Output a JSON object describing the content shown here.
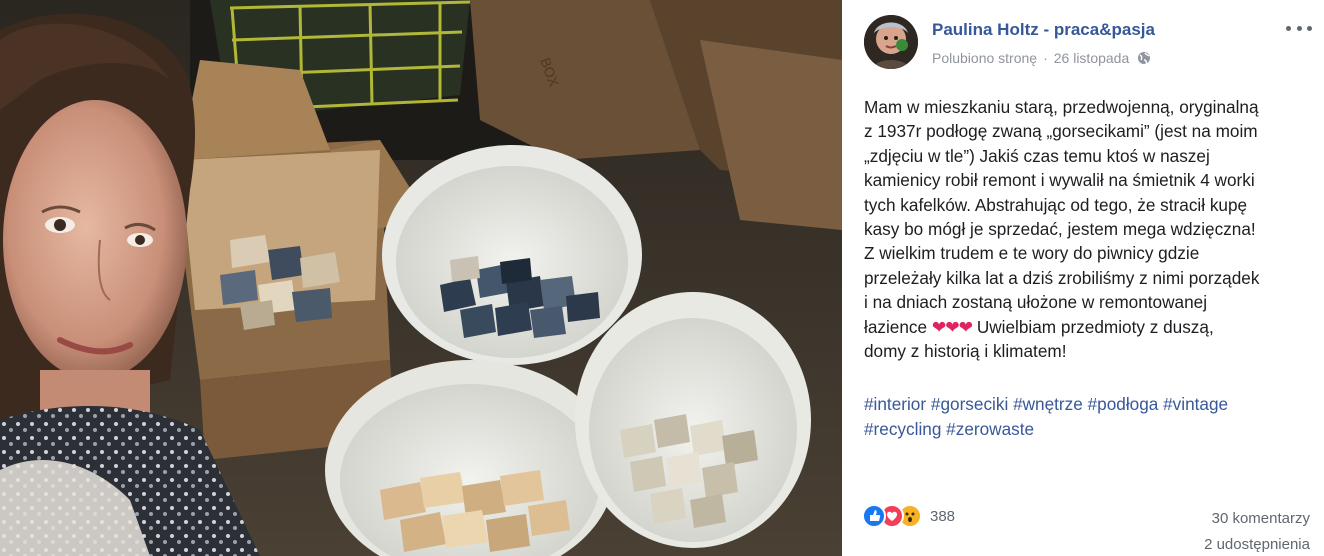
{
  "post": {
    "author": "Paulina Holtz - praca&pasja",
    "liked_page": "Polubiono stronę",
    "meta_sep": "·",
    "date": "26 listopada",
    "privacy_icon": "globe-icon",
    "more_icon": "more-options-icon",
    "text_lines": [
      "Mam w mieszkaniu starą, przedwojenną, oryginalną",
      "z 1937r podłogę zwaną „gorsecikami” (jest na moim",
      "„zdjęciu w tle”) Jakiś czas temu ktoś w naszej",
      "kamienicy robił remont i wywalił na śmietnik 4 worki",
      "tych kafelków. Abstrahując od tego, że stracił kupę",
      "kasy bo mógł je sprzedać, jestem mega wdzięczna!",
      "Z wielkim trudem e te wory do piwnicy gdzie",
      "przeleżały kilka lat a dziś zrobiliśmy z nimi porządek",
      "i na dniach zostaną ułożone w remontowanej",
      "łazience",
      "Uwielbiam przedmioty z duszą,",
      "domy z historią i klimatem!"
    ],
    "hearts": "❤❤❤",
    "hashtags": [
      "#interior",
      "#gorseciki",
      "#wnętrze",
      "#podłoga",
      "#vintage",
      "#recycling",
      "#zerowaste"
    ],
    "reactions": {
      "icons": [
        "like-reaction-icon",
        "love-reaction-icon",
        "wow-reaction-icon"
      ],
      "count": "388"
    },
    "comments": "30 komentarzy",
    "shares": "2 udostępnienia"
  },
  "photo": {
    "description_icon": "post-photo"
  },
  "colors": {
    "link": "#365899",
    "hashtag": "#385898",
    "meta": "#90949c",
    "like": "#1877f2",
    "love": "#f33e58",
    "wow": "#f7b125"
  }
}
